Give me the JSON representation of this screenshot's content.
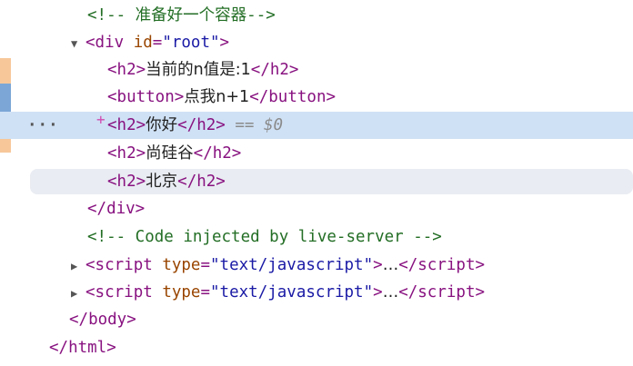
{
  "lines": {
    "comment_container": "<!-- 准备好一个容器-->",
    "div_open_tag": "div",
    "div_attr_name": "id",
    "div_attr_value": "\"root\"",
    "h2_1_text": "当前的n值是:1",
    "button_text": "点我n+1",
    "h2_2_text": "你好",
    "selected_marker": "== $0",
    "h2_3_text": "尚硅谷",
    "h2_4_text": "北京",
    "div_close": "</div>",
    "comment_injected": "<!-- Code injected by live-server -->",
    "script_tag": "script",
    "script_attr_name": "type",
    "script_attr_value": "\"text/javascript\"",
    "collapsed_content": "…",
    "body_close": "</body>",
    "html_close": "</html>"
  },
  "colors": {
    "selected_row": "#cfe1f5",
    "hover_row": "#e9ecf2",
    "tag": "#881280",
    "attr_name": "#994500",
    "attr_value": "#1a1aa6",
    "comment": "#236e25"
  },
  "icons": {
    "expand": "triangle-down-icon",
    "collapse": "triangle-right-icon",
    "more": "ellipsis-icon",
    "add": "plus-icon"
  }
}
